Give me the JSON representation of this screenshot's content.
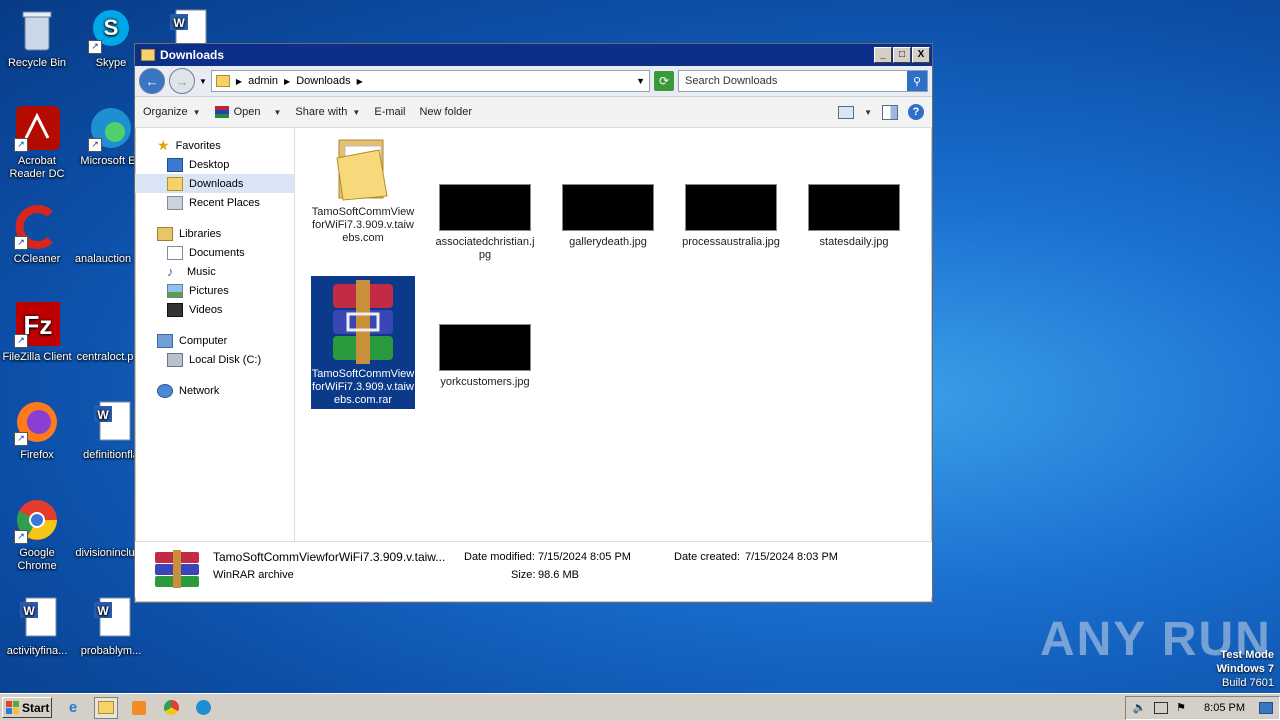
{
  "desktop": {
    "icons": [
      {
        "label": "Recycle Bin"
      },
      {
        "label": "Skype"
      },
      {
        "label": "Acrobat Reader DC"
      },
      {
        "label": "Microsoft Ed"
      },
      {
        "label": "CCleaner"
      },
      {
        "label": "analauction"
      },
      {
        "label": "FileZilla Client"
      },
      {
        "label": "centraloct.p"
      },
      {
        "label": "Firefox"
      },
      {
        "label": "definitionfla"
      },
      {
        "label": "Google Chrome"
      },
      {
        "label": "divisioninclu"
      },
      {
        "label": "activityfina..."
      },
      {
        "label": "probablym..."
      }
    ]
  },
  "window": {
    "title": "Downloads",
    "controls": {
      "minimize": "_",
      "maximize": "□",
      "close": "X"
    },
    "breadcrumb": [
      "admin",
      "Downloads"
    ],
    "search_placeholder": "Search Downloads",
    "toolbar": {
      "organize": "Organize",
      "open": "Open",
      "share_with": "Share with",
      "email": "E-mail",
      "new_folder": "New folder"
    },
    "nav": {
      "favorites": "Favorites",
      "desktop": "Desktop",
      "downloads": "Downloads",
      "recent_places": "Recent Places",
      "libraries": "Libraries",
      "documents": "Documents",
      "music": "Music",
      "pictures": "Pictures",
      "videos": "Videos",
      "computer": "Computer",
      "local_disk": "Local Disk (C:)",
      "network": "Network"
    },
    "files": [
      {
        "name": "TamoSoftCommViewforWiFi7.3.909.v.taiwebs.com",
        "type": "folder"
      },
      {
        "name": "associatedchristian.jpg",
        "type": "image"
      },
      {
        "name": "gallerydeath.jpg",
        "type": "image"
      },
      {
        "name": "processaustralia.jpg",
        "type": "image"
      },
      {
        "name": "statesdaily.jpg",
        "type": "image"
      },
      {
        "name": "TamoSoftCommViewforWiFi7.3.909.v.taiwebs.com.rar",
        "type": "rar",
        "selected": true
      },
      {
        "name": "yorkcustomers.jpg",
        "type": "image"
      }
    ],
    "status": {
      "filename": "TamoSoftCommViewforWiFi7.3.909.v.taiw...",
      "filetype": "WinRAR archive",
      "date_modified_label": "Date modified:",
      "date_modified": "7/15/2024 8:05 PM",
      "date_created_label": "Date created:",
      "date_created": "7/15/2024 8:03 PM",
      "size_label": "Size:",
      "size": "98.6 MB"
    }
  },
  "taskbar": {
    "start": "Start",
    "clock": "8:05 PM"
  },
  "watermark": "ANY RUN",
  "os_info": {
    "line1": "Test Mode",
    "line2": "Windows 7",
    "line3": "Build 7601"
  }
}
